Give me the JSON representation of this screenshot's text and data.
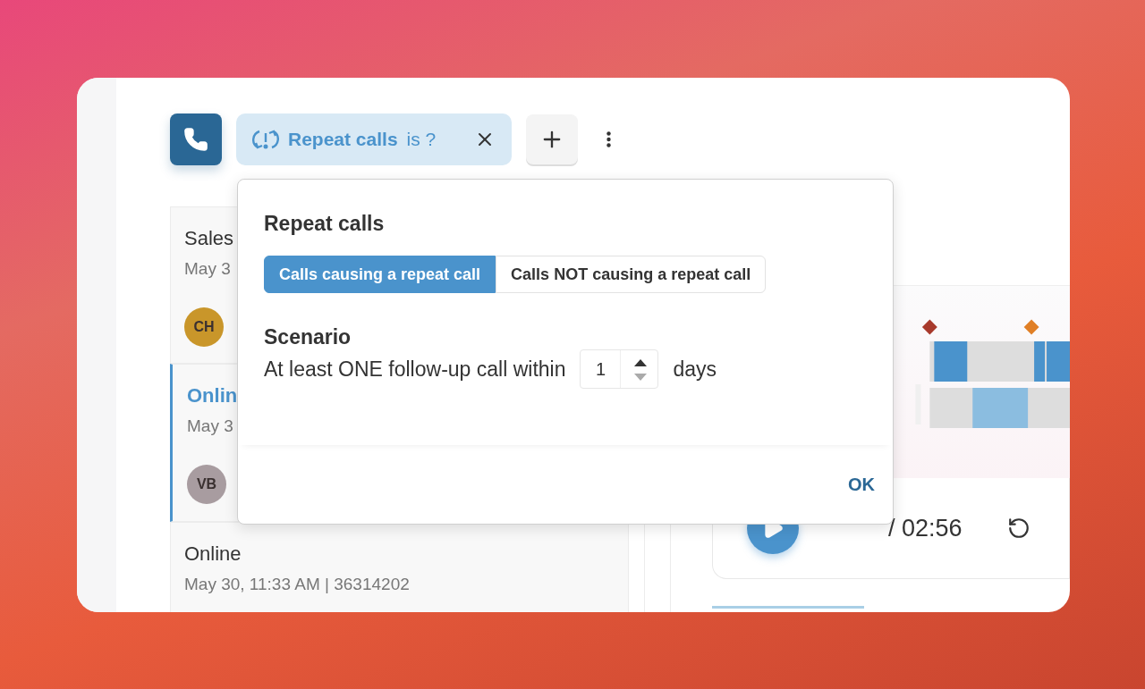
{
  "filter_chip": {
    "field": "Repeat calls",
    "operator": "is ?"
  },
  "calls": [
    {
      "title": "Sales",
      "subtitle": "May 3",
      "initials": "CH",
      "color": "#c9962a",
      "selected": false
    },
    {
      "title": "Onlin",
      "subtitle": "May 3",
      "initials": "VB",
      "color": "#a89ca0",
      "selected": true
    },
    {
      "title": "Online",
      "subtitle": "May 30, 11:33 AM | 36314202",
      "selected": false
    }
  ],
  "player": {
    "time": "/ 02:56"
  },
  "popover": {
    "title": "Repeat calls",
    "options": [
      {
        "label": "Calls causing a repeat call",
        "selected": true
      },
      {
        "label": "Calls NOT causing a repeat call",
        "selected": false
      }
    ],
    "scenario_title": "Scenario",
    "sentence": "At least ONE follow-up call within",
    "days_value": "1",
    "unit": "days",
    "ok": "OK"
  }
}
